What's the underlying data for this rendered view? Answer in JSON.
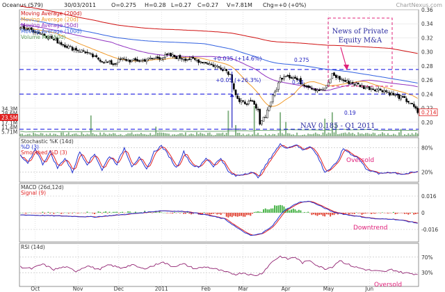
{
  "header": {
    "symbol": "Oceanus (579)",
    "date": "30/03/2011",
    "open": "O=0.275",
    "high": "H=0.28",
    "low": "L=0.27",
    "close": "C=0.27",
    "volume": "V=7.81M",
    "change": "Chg=+0 (+0%)",
    "watermark": "ChartNexus.com"
  },
  "colors": {
    "ma200": "#d01010",
    "ma20": "#f09a2a",
    "ma50": "#9030c0",
    "ma100": "#3060e0",
    "vol_ma": "#60a060",
    "dashed": "#2020e0",
    "annotation": "#e0207a",
    "stoch_k": "#2030d0",
    "stoch_d": "#e02020",
    "macd": "#2030d0",
    "signal": "#e02020",
    "rsi": "#902070",
    "hist_pos": "#40b040",
    "hist_neg": "#e04030",
    "volume_bar": "#80b080"
  },
  "chart_data": [
    {
      "type": "candlestick",
      "panel": "price",
      "legend": [
        {
          "name": "Moving Average (200d)",
          "color": "#d01010"
        },
        {
          "name": "Moving Average (20d)",
          "color": "#f09a2a"
        },
        {
          "name": "Moving Average (50d)",
          "color": "#9030c0"
        },
        {
          "name": "Moving Average (100d)",
          "color": "#3060e0"
        },
        {
          "name": "Volume MA (50d)",
          "color": "#60a060"
        }
      ],
      "price_ticks": [
        "0.36",
        "0.34",
        "0.32",
        "0.30",
        "0.28",
        "0.26",
        "0.24",
        "0.22",
        "0.20"
      ],
      "price_tick_values": [
        0.36,
        0.34,
        0.32,
        0.3,
        0.28,
        0.26,
        0.24,
        0.22,
        0.2
      ],
      "ylim": [
        0.18,
        0.36
      ],
      "volume_ticks": [
        "34.3M",
        "28.6M",
        "23.5M",
        "17.1M",
        "11.4M",
        "5.71M"
      ],
      "volume_tick_values": [
        34.3,
        28.6,
        23.5,
        17.1,
        11.4,
        5.71
      ],
      "volume_ylim": [
        0,
        40
      ],
      "last_price_label": "0.214",
      "last_price": 0.214,
      "current_volume_label": "23.5M",
      "x_labels": [
        "Oct",
        "Nov",
        "Dec",
        "2011",
        "Feb",
        "Mar",
        "Apr",
        "May",
        "Jun"
      ],
      "x_label_index": [
        8,
        31,
        53,
        76,
        100,
        120,
        143,
        166,
        188
      ],
      "dashed_levels": [
        0.275,
        0.24,
        0.19
      ],
      "close_anchors": [
        [
          0,
          0.335
        ],
        [
          8,
          0.33
        ],
        [
          15,
          0.322
        ],
        [
          22,
          0.312
        ],
        [
          28,
          0.305
        ],
        [
          35,
          0.3
        ],
        [
          40,
          0.292
        ],
        [
          46,
          0.286
        ],
        [
          50,
          0.283
        ],
        [
          55,
          0.29
        ],
        [
          60,
          0.287
        ],
        [
          65,
          0.288
        ],
        [
          70,
          0.29
        ],
        [
          75,
          0.292
        ],
        [
          80,
          0.295
        ],
        [
          85,
          0.292
        ],
        [
          90,
          0.29
        ],
        [
          95,
          0.288
        ],
        [
          100,
          0.285
        ],
        [
          105,
          0.28
        ],
        [
          110,
          0.276
        ],
        [
          113,
          0.268
        ],
        [
          116,
          0.24
        ],
        [
          118,
          0.228
        ],
        [
          125,
          0.228
        ],
        [
          128,
          0.215
        ],
        [
          129,
          0.2
        ],
        [
          132,
          0.21
        ],
        [
          135,
          0.23
        ],
        [
          138,
          0.248
        ],
        [
          140,
          0.262
        ],
        [
          143,
          0.268
        ],
        [
          148,
          0.262
        ],
        [
          152,
          0.255
        ],
        [
          158,
          0.248
        ],
        [
          162,
          0.245
        ],
        [
          165,
          0.25
        ],
        [
          168,
          0.268
        ],
        [
          170,
          0.265
        ],
        [
          175,
          0.258
        ],
        [
          180,
          0.255
        ],
        [
          185,
          0.25
        ],
        [
          190,
          0.248
        ],
        [
          195,
          0.246
        ],
        [
          200,
          0.24
        ],
        [
          205,
          0.235
        ],
        [
          210,
          0.228
        ],
        [
          214,
          0.214
        ]
      ],
      "annotations": {
        "gap1": "+0.035 (+14.6%)",
        "gap2": "+0.05 (+26.3%)",
        "level_a": "0.275",
        "level_b": "0.24",
        "level_c": "0.19",
        "nav": "NAV 0.185 - Q1 2011",
        "news": [
          "News of Private",
          "Equity M&A"
        ]
      }
    },
    {
      "type": "line",
      "panel": "stochastic",
      "title": "Stochastic %K (14d)",
      "series": [
        {
          "name": "%D (3)",
          "color": "#2030d0"
        },
        {
          "name": "Smoothed %D (3)",
          "color": "#e02020"
        }
      ],
      "ticks": [
        "80%",
        "20%"
      ],
      "tick_values": [
        80,
        20
      ],
      "ylim": [
        0,
        100
      ],
      "k_anchors": [
        [
          0,
          60
        ],
        [
          4,
          40
        ],
        [
          8,
          78
        ],
        [
          12,
          40
        ],
        [
          16,
          70
        ],
        [
          20,
          30
        ],
        [
          24,
          55
        ],
        [
          28,
          20
        ],
        [
          32,
          70
        ],
        [
          36,
          40
        ],
        [
          40,
          65
        ],
        [
          44,
          25
        ],
        [
          48,
          60
        ],
        [
          52,
          40
        ],
        [
          56,
          80
        ],
        [
          60,
          35
        ],
        [
          64,
          55
        ],
        [
          68,
          25
        ],
        [
          72,
          70
        ],
        [
          76,
          85
        ],
        [
          80,
          60
        ],
        [
          84,
          30
        ],
        [
          88,
          70
        ],
        [
          92,
          40
        ],
        [
          96,
          30
        ],
        [
          100,
          55
        ],
        [
          104,
          35
        ],
        [
          108,
          55
        ],
        [
          112,
          20
        ],
        [
          116,
          10
        ],
        [
          120,
          15
        ],
        [
          124,
          20
        ],
        [
          128,
          8
        ],
        [
          132,
          35
        ],
        [
          136,
          65
        ],
        [
          140,
          88
        ],
        [
          144,
          80
        ],
        [
          148,
          88
        ],
        [
          152,
          75
        ],
        [
          156,
          85
        ],
        [
          160,
          60
        ],
        [
          164,
          20
        ],
        [
          167,
          28
        ],
        [
          170,
          40
        ],
        [
          174,
          78
        ],
        [
          178,
          65
        ],
        [
          182,
          55
        ],
        [
          186,
          30
        ],
        [
          190,
          20
        ],
        [
          194,
          15
        ],
        [
          198,
          20
        ],
        [
          202,
          18
        ],
        [
          206,
          15
        ],
        [
          210,
          17
        ],
        [
          214,
          20
        ]
      ],
      "label": "Oversold"
    },
    {
      "type": "line",
      "panel": "macd",
      "title": "MACD (26d,12d)",
      "series": [
        {
          "name": "Signal (9)",
          "color": "#e02020"
        }
      ],
      "ticks": [
        "0.016",
        "0",
        "-0.016"
      ],
      "tick_values": [
        0.016,
        0,
        -0.016
      ],
      "ylim": [
        -0.026,
        0.026
      ],
      "macd_anchors": [
        [
          0,
          -0.002
        ],
        [
          20,
          -0.003
        ],
        [
          40,
          -0.004
        ],
        [
          60,
          -0.001
        ],
        [
          76,
          0.002
        ],
        [
          90,
          0.001
        ],
        [
          100,
          -0.002
        ],
        [
          110,
          -0.006
        ],
        [
          118,
          -0.016
        ],
        [
          124,
          -0.022
        ],
        [
          130,
          -0.02
        ],
        [
          136,
          -0.012
        ],
        [
          142,
          0.002
        ],
        [
          150,
          0.01
        ],
        [
          156,
          0.011
        ],
        [
          162,
          0.006
        ],
        [
          168,
          0.001
        ],
        [
          176,
          -0.002
        ],
        [
          184,
          -0.004
        ],
        [
          192,
          -0.006
        ],
        [
          200,
          -0.006
        ],
        [
          208,
          -0.008
        ],
        [
          214,
          -0.01
        ]
      ],
      "label": "Downtrend"
    },
    {
      "type": "line",
      "panel": "rsi",
      "title": "RSI (14d)",
      "ticks": [
        "70%",
        "30%"
      ],
      "tick_values": [
        70,
        30
      ],
      "ylim": [
        0,
        100
      ],
      "rsi_anchors": [
        [
          0,
          45
        ],
        [
          6,
          40
        ],
        [
          12,
          52
        ],
        [
          18,
          38
        ],
        [
          24,
          45
        ],
        [
          30,
          34
        ],
        [
          36,
          48
        ],
        [
          42,
          38
        ],
        [
          48,
          50
        ],
        [
          54,
          42
        ],
        [
          60,
          50
        ],
        [
          66,
          40
        ],
        [
          72,
          48
        ],
        [
          76,
          58
        ],
        [
          82,
          46
        ],
        [
          88,
          52
        ],
        [
          94,
          40
        ],
        [
          100,
          45
        ],
        [
          106,
          38
        ],
        [
          110,
          32
        ],
        [
          116,
          26
        ],
        [
          120,
          30
        ],
        [
          126,
          22
        ],
        [
          130,
          28
        ],
        [
          136,
          60
        ],
        [
          140,
          72
        ],
        [
          144,
          65
        ],
        [
          148,
          70
        ],
        [
          152,
          55
        ],
        [
          156,
          62
        ],
        [
          160,
          48
        ],
        [
          164,
          40
        ],
        [
          168,
          45
        ],
        [
          172,
          62
        ],
        [
          176,
          52
        ],
        [
          180,
          45
        ],
        [
          186,
          38
        ],
        [
          190,
          35
        ],
        [
          196,
          32
        ],
        [
          200,
          38
        ],
        [
          206,
          30
        ],
        [
          210,
          28
        ],
        [
          214,
          26
        ]
      ],
      "label": "Oversold"
    }
  ]
}
